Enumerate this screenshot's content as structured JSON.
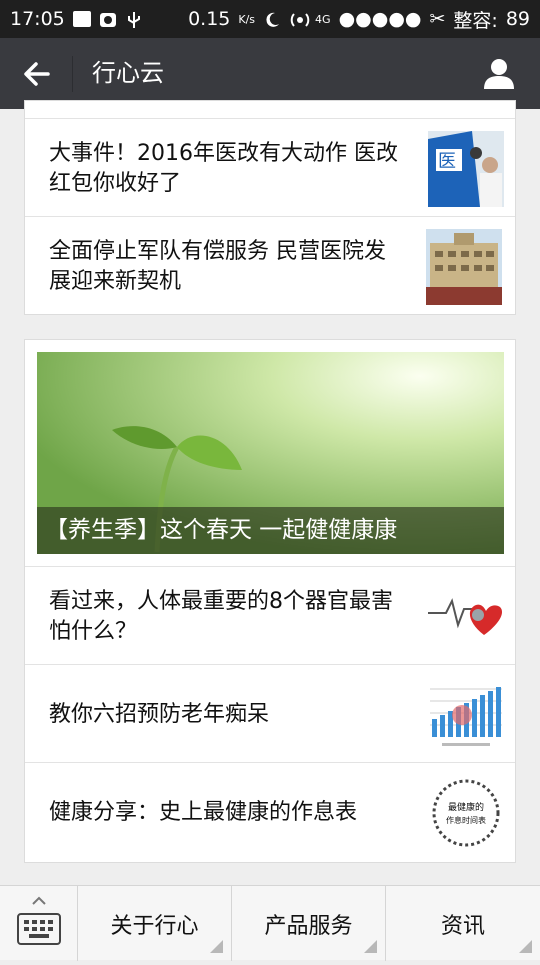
{
  "status_bar": {
    "time": "17:05",
    "speed": "0.15",
    "speed_unit": "K/s",
    "network": "4G",
    "storage_label": "整容:",
    "battery": "89"
  },
  "nav": {
    "title": "行心云"
  },
  "articles_top": [
    {
      "title": "大事件！2016年医改有大动作 医改红包你收好了"
    },
    {
      "title": "全面停止军队有偿服务 民营医院发展迎来新契机"
    }
  ],
  "featured": {
    "caption": "【养生季】这个春天 一起健健康康"
  },
  "articles_bottom": [
    {
      "title": "看过来，人体最重要的8个器官最害怕什么？"
    },
    {
      "title": "教你六招预防老年痴呆"
    },
    {
      "title": "健康分享：史上最健康的作息表"
    }
  ],
  "thumb_text": {
    "schedule_line1": "最健康的",
    "schedule_line2": "作息时间表"
  },
  "bottom_menu": [
    {
      "label": "关于行心"
    },
    {
      "label": "产品服务"
    },
    {
      "label": "资讯"
    }
  ],
  "colors": {
    "nav_bg": "#393a3f",
    "status_bg": "#1f1f1f",
    "page_bg": "#eeeeee"
  }
}
